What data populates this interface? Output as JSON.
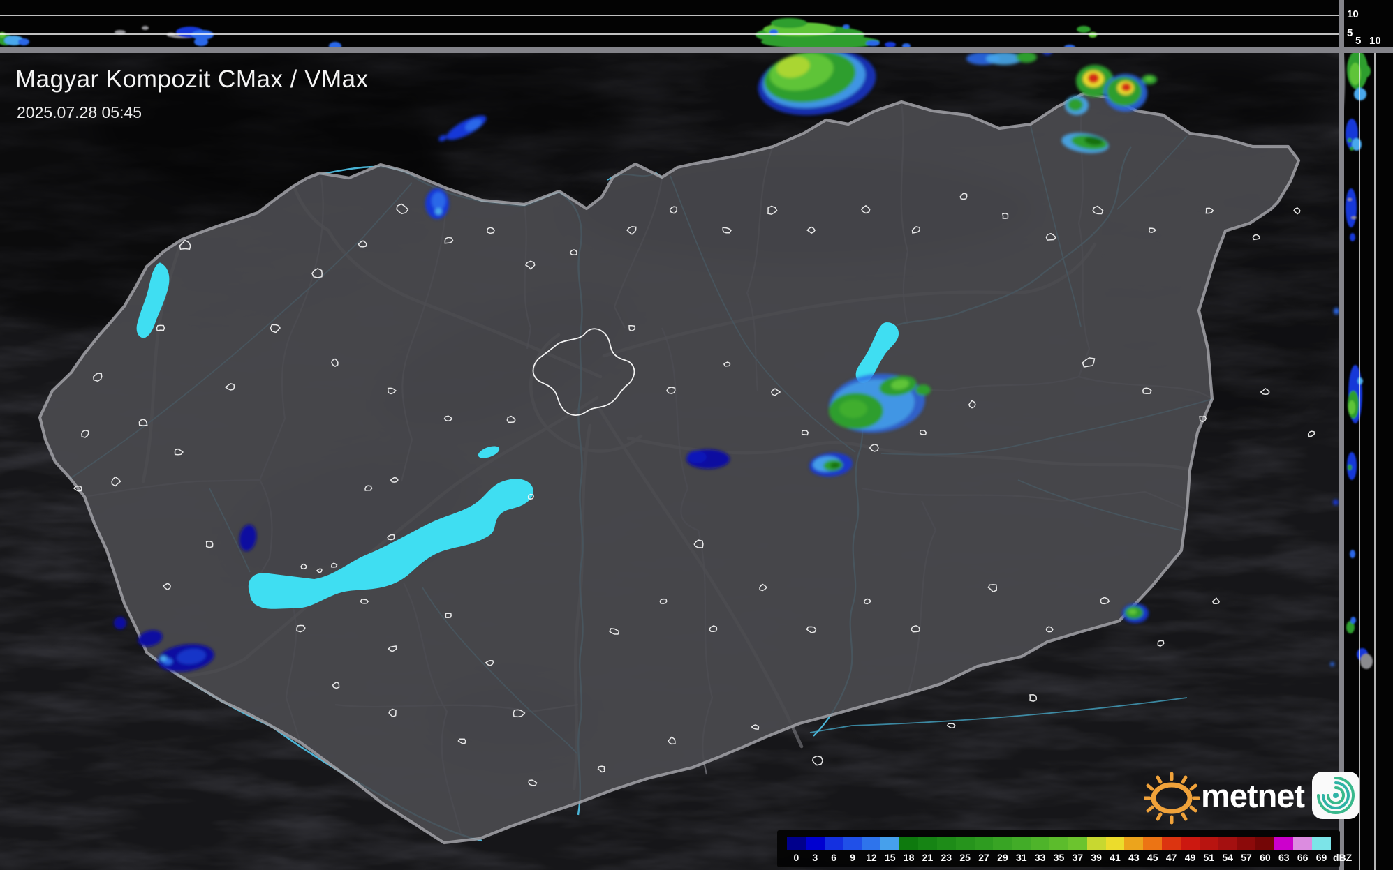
{
  "header": {
    "title": "Magyar Kompozit CMax / VMax",
    "timestamp": "2025.07.28 05:45"
  },
  "side_profile": {
    "top_axis_labels": [
      "10",
      "5"
    ],
    "right_axis_labels": [
      "5",
      "10"
    ]
  },
  "legend": {
    "unit": "dBZ",
    "cells": [
      {
        "value": "0",
        "color": "#00008c"
      },
      {
        "value": "3",
        "color": "#0000d0"
      },
      {
        "value": "6",
        "color": "#1430e0"
      },
      {
        "value": "9",
        "color": "#2050e8"
      },
      {
        "value": "12",
        "color": "#2e74ec"
      },
      {
        "value": "15",
        "color": "#46a0ec"
      },
      {
        "value": "18",
        "color": "#0e7a0e"
      },
      {
        "value": "21",
        "color": "#168414"
      },
      {
        "value": "23",
        "color": "#1e8c18"
      },
      {
        "value": "25",
        "color": "#26941c"
      },
      {
        "value": "27",
        "color": "#2e9c20"
      },
      {
        "value": "29",
        "color": "#38a424"
      },
      {
        "value": "31",
        "color": "#42ac28"
      },
      {
        "value": "33",
        "color": "#4eb42a"
      },
      {
        "value": "35",
        "color": "#5cbc2c"
      },
      {
        "value": "37",
        "color": "#6cc42e"
      },
      {
        "value": "39",
        "color": "#c8d830"
      },
      {
        "value": "41",
        "color": "#ecdc2c"
      },
      {
        "value": "43",
        "color": "#eca41c"
      },
      {
        "value": "45",
        "color": "#ec7414"
      },
      {
        "value": "47",
        "color": "#dc3410"
      },
      {
        "value": "49",
        "color": "#cc1810"
      },
      {
        "value": "51",
        "color": "#b81410"
      },
      {
        "value": "54",
        "color": "#a41010"
      },
      {
        "value": "57",
        "color": "#8c0a0a"
      },
      {
        "value": "60",
        "color": "#740606"
      },
      {
        "value": "63",
        "color": "#cc00cc"
      },
      {
        "value": "66",
        "color": "#dc8ce0"
      },
      {
        "value": "69",
        "color": "#7ce4e8"
      }
    ]
  },
  "logo": {
    "brand": "metnet"
  },
  "colors": {
    "map_bg": "#2e2e33",
    "country_fill": "#47474c",
    "border": "#9f9fa4",
    "county": "#6a6a70",
    "motorway": "#87878d",
    "river": "#4fc3e8",
    "lake": "#3fdef2",
    "city_outline": "#f2f2f2",
    "strip_bg": "#030303",
    "separator": "#84848a",
    "gridline": "#ffffff"
  },
  "radar_echoes": {
    "map": [
      [
        1170,
        118,
        85,
        46,
        -8,
        "#1838d8",
        0.8
      ],
      [
        1166,
        114,
        74,
        40,
        -8,
        "#49a8ec",
        0.85
      ],
      [
        1160,
        110,
        66,
        36,
        -8,
        "#2f9e2f",
        1
      ],
      [
        1148,
        103,
        46,
        26,
        -10,
        "#5ec437",
        1
      ],
      [
        1136,
        96,
        24,
        15,
        -10,
        "#aad632",
        1
      ],
      [
        1408,
        84,
        24,
        9,
        0,
        "#2a68e8",
        0.9
      ],
      [
        1438,
        84,
        26,
        9,
        0,
        "#49a8ec",
        0.9
      ],
      [
        1470,
        82,
        15,
        8,
        0,
        "#2f9e2f",
        1
      ],
      [
        1500,
        74,
        7,
        5,
        0,
        "#1838d8",
        0.9
      ],
      [
        1568,
        116,
        27,
        23,
        0,
        "#2f9e2f",
        1
      ],
      [
        1566,
        113,
        15,
        12,
        0,
        "#ead92e",
        1
      ],
      [
        1566,
        112,
        8,
        7,
        0,
        "#d42a12",
        1
      ],
      [
        1612,
        133,
        31,
        27,
        0,
        "#2a68e8",
        0.85
      ],
      [
        1610,
        131,
        25,
        21,
        0,
        "#2f9e2f",
        1
      ],
      [
        1612,
        126,
        12,
        10,
        0,
        "#ead92e",
        1
      ],
      [
        1613,
        125,
        7,
        6,
        0,
        "#d42a12",
        1
      ],
      [
        1646,
        114,
        11,
        7,
        0,
        "#2f9e2f",
        1
      ],
      [
        1646,
        113,
        5,
        3,
        0,
        "#5ec437",
        1
      ],
      [
        1542,
        151,
        17,
        14,
        0,
        "#49a8ec",
        0.9
      ],
      [
        1540,
        150,
        11,
        9,
        0,
        "#2f9e2f",
        1
      ],
      [
        1554,
        205,
        34,
        14,
        8,
        "#49a8ec",
        0.9
      ],
      [
        1560,
        204,
        26,
        10,
        8,
        "#2f9e2f",
        1
      ],
      [
        1566,
        202,
        13,
        6,
        8,
        "#12700f",
        1
      ],
      [
        668,
        183,
        32,
        10,
        -28,
        "#1838d8",
        1
      ],
      [
        678,
        179,
        13,
        7,
        -28,
        "#2a68e8",
        1
      ],
      [
        634,
        198,
        6,
        4,
        -28,
        "#1838d8",
        1
      ],
      [
        626,
        292,
        17,
        22,
        0,
        "#1838d8",
        1
      ],
      [
        628,
        288,
        10,
        13,
        0,
        "#2a68e8",
        1
      ],
      [
        628,
        303,
        5,
        5,
        0,
        "#49a8ec",
        1
      ],
      [
        1014,
        658,
        31,
        14,
        0,
        "#0a0aa0",
        1
      ],
      [
        998,
        655,
        14,
        9,
        0,
        "#0d12b8",
        1
      ],
      [
        1256,
        578,
        69,
        42,
        -6,
        "#2a68e8",
        0.8
      ],
      [
        1250,
        580,
        60,
        36,
        -6,
        "#49a8ec",
        0.75
      ],
      [
        1226,
        589,
        39,
        26,
        0,
        "#2f9e2f",
        1
      ],
      [
        1222,
        586,
        20,
        13,
        0,
        "#3fae2f",
        1
      ],
      [
        1286,
        553,
        27,
        14,
        -10,
        "#2f9e2f",
        1
      ],
      [
        1289,
        551,
        13,
        7,
        -10,
        "#5ec437",
        1
      ],
      [
        1322,
        559,
        11,
        8,
        0,
        "#2f9e2f",
        1
      ],
      [
        1190,
        666,
        31,
        17,
        -5,
        "#1838d8",
        0.9
      ],
      [
        1184,
        665,
        20,
        11,
        -5,
        "#49a8ec",
        0.9
      ],
      [
        1193,
        667,
        14,
        8,
        -5,
        "#2f9e2f",
        1
      ],
      [
        1196,
        667,
        7,
        4,
        -5,
        "#12700f",
        1
      ],
      [
        172,
        893,
        9,
        9,
        0,
        "#0a0aa0",
        1
      ],
      [
        215,
        915,
        18,
        11,
        -15,
        "#0a0aa0",
        1
      ],
      [
        266,
        943,
        41,
        19,
        -8,
        "#0a0aa0",
        1
      ],
      [
        274,
        941,
        21,
        11,
        -8,
        "#1535c8",
        1
      ],
      [
        240,
        948,
        7,
        5,
        0,
        "#2a68e8",
        1
      ],
      [
        234,
        944,
        5,
        4,
        0,
        "#49a8ec",
        1
      ],
      [
        355,
        771,
        12,
        19,
        10,
        "#0a0aa0",
        1
      ],
      [
        1626,
        879,
        19,
        14,
        0,
        "#1838d8",
        0.9
      ],
      [
        1624,
        878,
        13,
        9,
        0,
        "#2f9e2f",
        1
      ],
      [
        1622,
        877,
        6,
        4,
        0,
        "#5ec437",
        1
      ],
      [
        1914,
        446,
        4,
        5,
        0,
        "#2a68e8",
        1
      ],
      [
        1913,
        720,
        4,
        4,
        0,
        "#1838d8",
        1
      ],
      [
        1908,
        952,
        3,
        3,
        0,
        "#2a68e8",
        1
      ]
    ],
    "top_strip": [
      [
        8,
        57,
        12,
        8,
        0,
        "#2f9e2f",
        1
      ],
      [
        20,
        58,
        14,
        7,
        0,
        "#49a8ec",
        1
      ],
      [
        34,
        60,
        8,
        5,
        0,
        "#2a68e8",
        1
      ],
      [
        3,
        50,
        5,
        4,
        0,
        "#5ec437",
        1
      ],
      [
        172,
        46,
        8,
        3,
        0,
        "#909094",
        1
      ],
      [
        208,
        40,
        5,
        3,
        0,
        "#909094",
        1
      ],
      [
        245,
        50,
        6,
        3,
        0,
        "#909094",
        1
      ],
      [
        262,
        52,
        18,
        3,
        0,
        "#909094",
        1
      ],
      [
        272,
        46,
        20,
        8,
        0,
        "#1838d8",
        1
      ],
      [
        290,
        50,
        16,
        7,
        0,
        "#2a68e8",
        1
      ],
      [
        288,
        60,
        10,
        6,
        0,
        "#2a68e8",
        1
      ],
      [
        480,
        66,
        9,
        6,
        0,
        "#2a68e8",
        1
      ],
      [
        1160,
        50,
        78,
        14,
        0,
        "#2f9e2f",
        1
      ],
      [
        1175,
        60,
        85,
        10,
        0,
        "#2f9e2f",
        1
      ],
      [
        1145,
        42,
        52,
        10,
        0,
        "#5ec437",
        1
      ],
      [
        1130,
        33,
        26,
        7,
        0,
        "#2f9e2f",
        1
      ],
      [
        1250,
        62,
        10,
        4,
        0,
        "#2a68e8",
        1
      ],
      [
        1275,
        64,
        8,
        4,
        0,
        "#1838d8",
        1
      ],
      [
        1298,
        66,
        6,
        4,
        0,
        "#2a68e8",
        1
      ],
      [
        1212,
        38,
        5,
        3,
        0,
        "#2a68e8",
        1
      ],
      [
        1108,
        46,
        6,
        4,
        0,
        "#2a68e8",
        1
      ],
      [
        1532,
        68,
        8,
        4,
        0,
        "#2a68e8",
        1
      ],
      [
        1552,
        42,
        10,
        5,
        0,
        "#2f9e2f",
        1
      ],
      [
        1565,
        50,
        6,
        4,
        0,
        "#5ec437",
        1
      ]
    ],
    "right_strip": [
      [
        1944,
        100,
        15,
        28,
        0,
        "#2f9e2f",
        1
      ],
      [
        1941,
        106,
        8,
        16,
        0,
        "#5ec437",
        1
      ],
      [
        1956,
        102,
        7,
        9,
        0,
        "#2f9e2f",
        1
      ],
      [
        1948,
        135,
        9,
        9,
        0,
        "#49a8ec",
        1
      ],
      [
        1921,
        115,
        5,
        48,
        0,
        "#808084",
        1
      ],
      [
        1936,
        192,
        9,
        22,
        0,
        "#1838d8",
        1
      ],
      [
        1943,
        207,
        7,
        9,
        0,
        "#49a8ec",
        1
      ],
      [
        1933,
        201,
        3,
        3,
        0,
        "#2f9e2f",
        1
      ],
      [
        1936,
        213,
        3,
        3,
        0,
        "#2f9e2f",
        1
      ],
      [
        1935,
        298,
        8,
        28,
        0,
        "#1838d8",
        1
      ],
      [
        1933,
        286,
        3,
        2,
        0,
        "#909094",
        1
      ],
      [
        1939,
        312,
        4,
        2,
        0,
        "#909094",
        1
      ],
      [
        1937,
        340,
        4,
        6,
        0,
        "#1838d8",
        1
      ],
      [
        1941,
        565,
        10,
        42,
        0,
        "#1838d8",
        1
      ],
      [
        1938,
        580,
        8,
        20,
        0,
        "#2f9e2f",
        1
      ],
      [
        1936,
        584,
        5,
        10,
        0,
        "#5ec437",
        1
      ],
      [
        1948,
        546,
        4,
        5,
        0,
        "#49a8ec",
        1
      ],
      [
        1936,
        668,
        7,
        20,
        0,
        "#1838d8",
        1
      ],
      [
        1933,
        670,
        3,
        4,
        0,
        "#2f9e2f",
        1
      ],
      [
        1937,
        794,
        4,
        6,
        0,
        "#2a68e8",
        1
      ],
      [
        1934,
        899,
        6,
        9,
        0,
        "#2f9e2f",
        1
      ],
      [
        1938,
        889,
        4,
        5,
        0,
        "#2a68e8",
        1
      ],
      [
        1951,
        938,
        8,
        9,
        0,
        "#1838d8",
        1
      ],
      [
        1957,
        948,
        9,
        11,
        0,
        "#8a8a8e",
        1
      ]
    ]
  }
}
